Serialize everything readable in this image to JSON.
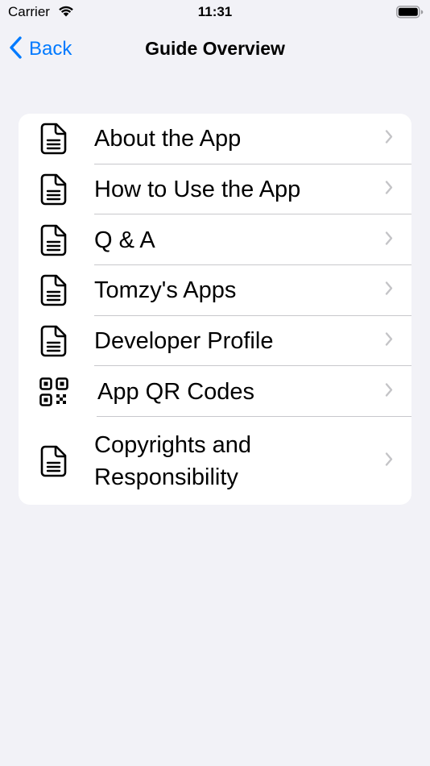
{
  "status_bar": {
    "carrier": "Carrier",
    "time": "11:31"
  },
  "nav": {
    "back_label": "Back",
    "title": "Guide Overview"
  },
  "items": [
    {
      "label": "About the App",
      "icon": "document-icon"
    },
    {
      "label": "How to Use the App",
      "icon": "document-icon"
    },
    {
      "label": "Q & A",
      "icon": "document-icon"
    },
    {
      "label": "Tomzy's Apps",
      "icon": "document-icon"
    },
    {
      "label": "Developer Profile",
      "icon": "document-icon"
    },
    {
      "label": "App QR Codes",
      "icon": "qr-code-icon"
    },
    {
      "label": "Copyrights and Responsibility",
      "icon": "document-icon"
    }
  ],
  "colors": {
    "accent": "#007aff",
    "background": "#f2f2f7",
    "card": "#ffffff",
    "chevron": "#c4c4c7"
  }
}
